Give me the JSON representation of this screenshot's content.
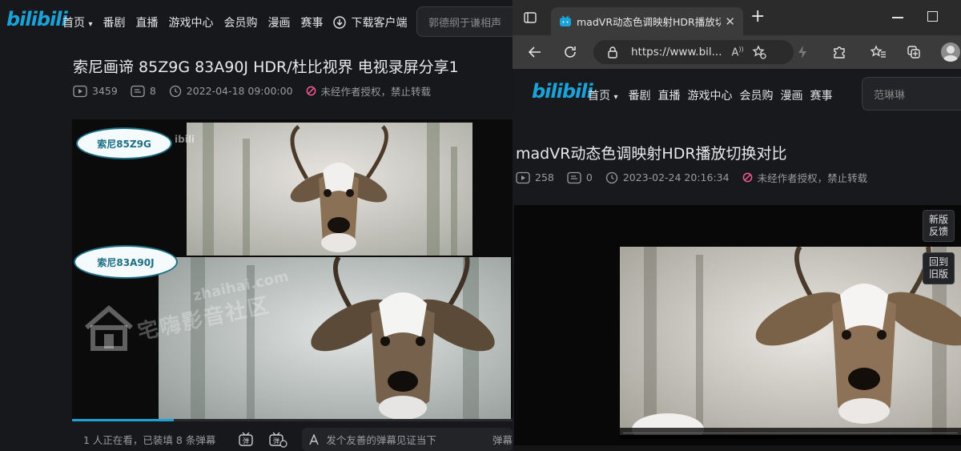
{
  "left": {
    "logo": "bilibili",
    "nav": {
      "home": "首页",
      "items": [
        "番剧",
        "直播",
        "游戏中心",
        "会员购",
        "漫画",
        "赛事"
      ],
      "download": "下载客户端"
    },
    "search": {
      "placeholder": "郭德纲于谦相声"
    },
    "video": {
      "title": "索尼画谛 85Z9G 83A90J HDR/杜比视界 电视录屏分享1",
      "views": "3459",
      "danmaku_count": "8",
      "date": "2022-04-18 09:00:00",
      "copyright": "未经作者授权，禁止转载",
      "label_top": "索尼85Z9G",
      "label_bottom": "索尼83A90J",
      "watermark_url": "zhaihai.com",
      "watermark_text": "宅嗨影音社区",
      "progress": 0.23
    },
    "danmaku_bar": {
      "status": "1 人正在看，已装填 8 条弹幕",
      "input_placeholder": "发个友善的弹幕见证当下",
      "send_partial": "弹幕"
    }
  },
  "right": {
    "tab": {
      "title": "madVR动态色调映射HDR播放切"
    },
    "address": {
      "url": "https://www.bil..."
    },
    "logo": "bilibili",
    "nav": {
      "home": "首页",
      "items": [
        "番剧",
        "直播",
        "游戏中心",
        "会员购",
        "漫画",
        "赛事"
      ]
    },
    "search": {
      "placeholder": "范琳琳"
    },
    "video": {
      "title": "madVR动态色调映射HDR播放切换对比",
      "views": "258",
      "danmaku_count": "0",
      "date": "2023-02-24 20:16:34",
      "copyright": "未经作者授权，禁止转载"
    },
    "side_buttons": {
      "feedback": "新版\n反馈",
      "old": "回到\n旧版"
    }
  },
  "colors": {
    "accent": "#1aa3d9",
    "bg": "#18191c",
    "warn": "#f25d8e"
  }
}
